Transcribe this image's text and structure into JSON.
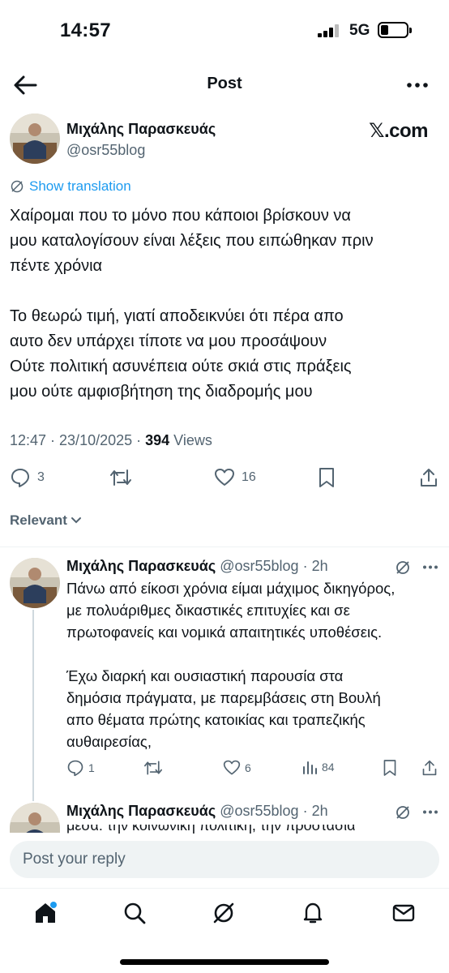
{
  "status": {
    "time": "14:57",
    "network": "5G"
  },
  "header": {
    "title": "Post"
  },
  "post": {
    "author": "Μιχάλης Παρασκευάς",
    "handle": "@osr55blog",
    "source": "𝕏.com",
    "translate_label": "Show translation",
    "lines": [
      "Χαίρομαι που το μόνο που κάποιοι βρίσκουν να",
      "μου καταλογίσουν είναι λέξεις που ειπώθηκαν πριν",
      "πέντε χρόνια",
      "",
      "Το θεωρώ τιμή, γιατί αποδεικνύει ότι πέρα απο",
      "αυτο δεν υπάρχει τίποτε να μου προσάψουν",
      "Ούτε πολιτική ασυνέπεια ούτε σκιά στις πράξεις",
      "μου ούτε αμφισβήτηση της διαδρομής μου"
    ],
    "timestamp": "12:47 · 23/10/2025 · ",
    "views_count": "394",
    "views_label": " Views",
    "replies": "3",
    "likes": "16"
  },
  "sort": {
    "label": "Relevant"
  },
  "reply1": {
    "author": "Μιχάλης Παρασκευάς",
    "handle": "@osr55blog",
    "time": "· 2h",
    "lines": [
      "Πάνω από είκοσι χρόνια είμαι μάχιμος δικηγόρος,",
      "με πολυάριθμες δικαστικές επιτυχίες και σε",
      "πρωτοφανείς και νομικά απαιτητικές υποθέσεις.",
      "",
      "Έχω διαρκή και ουσιαστική παρουσία στα",
      "δημόσια πράγματα, με παρεμβάσεις στη Βουλή",
      "απο θέματα πρώτης κατοικίας και τραπεζικής",
      "αυθαιρεσίας,"
    ],
    "replies": "1",
    "likes": "6",
    "views": "84"
  },
  "reply2": {
    "author": "Μιχάλης Παρασκευάς",
    "handle": "@osr55blog",
    "time": "· 2h",
    "partial": "μέσα: την κοινωνική πολιτική, την προστασία"
  },
  "composer": {
    "placeholder": "Post your reply"
  },
  "icons": [
    "back-arrow-icon",
    "more-icon",
    "translate-icon",
    "reply-icon",
    "repost-icon",
    "like-icon",
    "bookmark-icon",
    "share-icon",
    "analytics-icon",
    "grok-icon",
    "home-icon",
    "search-icon",
    "notifications-icon",
    "messages-icon"
  ],
  "colors": {
    "accent": "#1d9bf0",
    "secondary_text": "#536471",
    "text": "#0f1419"
  }
}
